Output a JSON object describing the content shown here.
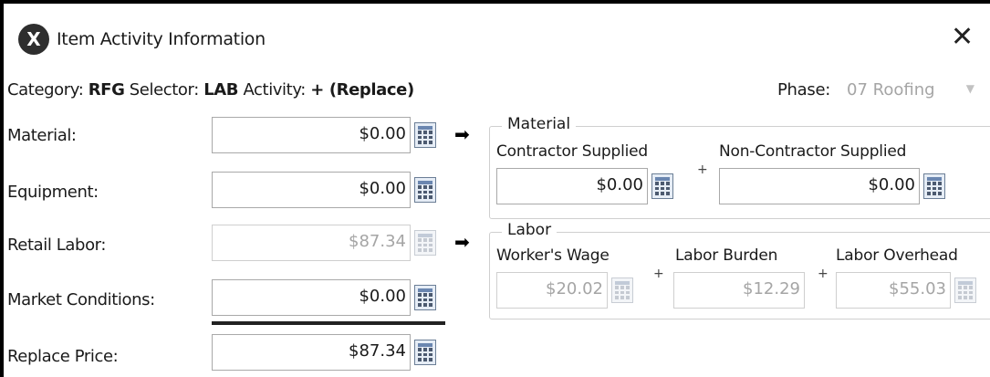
{
  "window": {
    "title": "Item Activity Information",
    "close_glyph": "✕",
    "app_icon_glyph": "X"
  },
  "header": {
    "category_label": "Category:",
    "category_value": "RFG",
    "selector_label": "Selector:",
    "selector_value": "LAB",
    "activity_label": "Activity:",
    "activity_value": "+ (Replace)",
    "phase_label": "Phase:",
    "phase_value": "07 Roofing"
  },
  "rows": {
    "material": {
      "label": "Material:",
      "value": "$0.00"
    },
    "equipment": {
      "label": "Equipment:",
      "value": "$0.00"
    },
    "retail_labor": {
      "label": "Retail Labor:",
      "value": "$87.34"
    },
    "market_conditions": {
      "label": "Market Conditions:",
      "value": "$0.00"
    },
    "replace_price": {
      "label": "Replace Price:",
      "value": "$87.34"
    }
  },
  "material_group": {
    "title": "Material",
    "contractor_label": "Contractor Supplied",
    "contractor_value": "$0.00",
    "non_contractor_label": "Non-Contractor Supplied",
    "non_contractor_value": "$0.00",
    "plus": "+"
  },
  "labor_group": {
    "title": "Labor",
    "wage_label": "Worker's Wage",
    "wage_value": "$20.02",
    "burden_label": "Labor Burden",
    "burden_value": "$12.29",
    "overhead_label": "Labor Overhead",
    "overhead_value": "$55.03",
    "plus": "+"
  },
  "icons": {
    "arrow_glyph": "➡",
    "dropdown_glyph": "▼",
    "calculator": "calculator-icon"
  }
}
